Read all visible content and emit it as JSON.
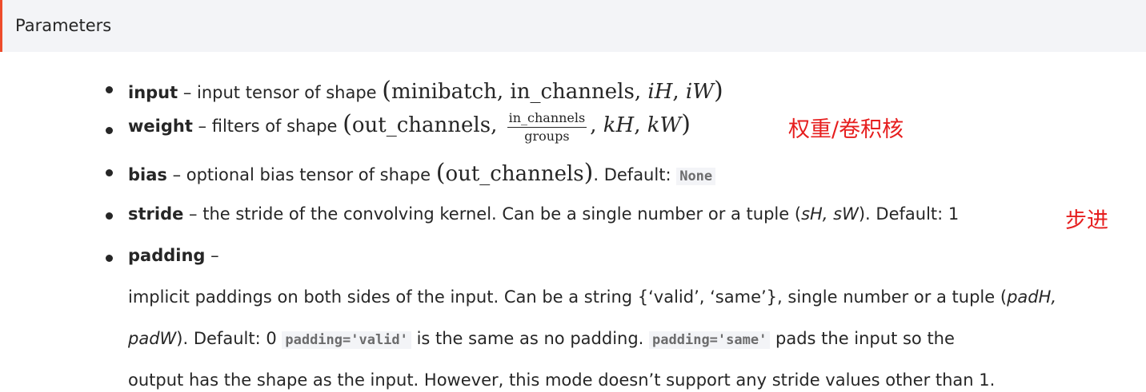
{
  "header": {
    "title": "Parameters"
  },
  "params": {
    "input": {
      "name": "input",
      "desc": " – input tensor of shape ",
      "math_open": "(",
      "math_body": "minibatch, in_channels, ",
      "math_iH": "iH",
      "math_sep": ", ",
      "math_iW": "iW",
      "math_close": ")"
    },
    "weight": {
      "name": "weight",
      "desc": " – filters of shape ",
      "math_open": "(",
      "math_body": "out_channels, ",
      "frac_num": "in_channels",
      "frac_den": "groups",
      "math_sep1": ", ",
      "math_kH": "kH",
      "math_sep2": ", ",
      "math_kW": "kW",
      "math_close": ")",
      "annotation": "权重/卷积核"
    },
    "bias": {
      "name": "bias",
      "desc": " – optional bias tensor of shape ",
      "math_open": "(",
      "math_body": "out_channels",
      "math_close": ")",
      "after": ". Default: ",
      "default_code": "None"
    },
    "stride": {
      "name": "stride",
      "desc": " – the stride of the convolving kernel. Can be a single number or a tuple (",
      "tuple": "sH, sW",
      "after": "). Default: 1",
      "annotation": "步进"
    },
    "padding": {
      "name": "padding",
      "dash": " –",
      "line1_a": "implicit paddings on both sides of the input. Can be a string {‘valid’, ‘same’}, single number or a tuple (",
      "line1_b": "padH,",
      "line2_a": "padW",
      "line2_b": "). Default: 0 ",
      "code1": "padding='valid'",
      "line2_c": " is the same as no padding. ",
      "code2": "padding='same'",
      "line2_d": " pads the input so the",
      "line3": "output has the shape as the input. However, this mode doesn’t support any stride values other than 1."
    }
  }
}
